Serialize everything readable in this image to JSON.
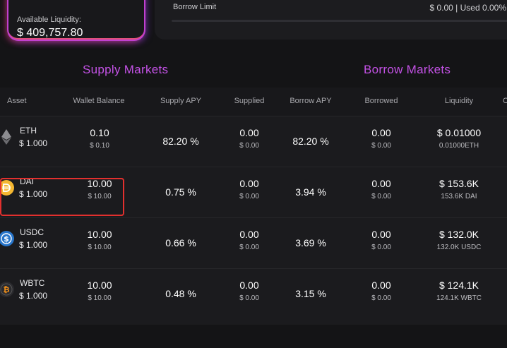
{
  "liquidity": {
    "label": "Available Liquidity:",
    "value": "$ 409,757.80"
  },
  "borrow_limit": {
    "label": "Borrow Limit",
    "value": "$ 0.00 | Used 0.00%"
  },
  "markets": {
    "supply_title": "Supply Markets",
    "borrow_title": "Borrow Markets"
  },
  "columns": {
    "asset": "Asset",
    "wallet_balance": "Wallet Balance",
    "supply_apy": "Supply APY",
    "supplied": "Supplied",
    "borrow_apy": "Borrow APY",
    "borrowed": "Borrowed",
    "liquidity": "Liquidity",
    "extra": "C"
  },
  "rows": [
    {
      "symbol": "ETH",
      "icon": "eth-icon",
      "icon_color": "#2a2a2e",
      "price": "$ 1.000",
      "wallet": "0.10",
      "wallet_usd": "$ 0.10",
      "supply_apy": "82.20 %",
      "supplied": "0.00",
      "supplied_usd": "$ 0.00",
      "borrow_apy": "82.20 %",
      "borrowed": "0.00",
      "borrowed_usd": "$ 0.00",
      "liquidity": "$ 0.01000",
      "liquidity_sub": "0.01000ETH"
    },
    {
      "symbol": "DAI",
      "icon": "dai-icon",
      "icon_color": "#f4b731",
      "price": "$ 1.000",
      "wallet": "10.00",
      "wallet_usd": "$ 10.00",
      "supply_apy": "0.75 %",
      "supplied": "0.00",
      "supplied_usd": "$ 0.00",
      "borrow_apy": "3.94 %",
      "borrowed": "0.00",
      "borrowed_usd": "$ 0.00",
      "liquidity": "$ 153.6K",
      "liquidity_sub": "153.6K DAI"
    },
    {
      "symbol": "USDC",
      "icon": "usdc-icon",
      "icon_color": "#2775ca",
      "price": "$ 1.000",
      "wallet": "10.00",
      "wallet_usd": "$ 10.00",
      "supply_apy": "0.66 %",
      "supplied": "0.00",
      "supplied_usd": "$ 0.00",
      "borrow_apy": "3.69 %",
      "borrowed": "0.00",
      "borrowed_usd": "$ 0.00",
      "liquidity": "$ 132.0K",
      "liquidity_sub": "132.0K USDC"
    },
    {
      "symbol": "WBTC",
      "icon": "wbtc-icon",
      "icon_color": "#2a2a2e",
      "price": "$ 1.000",
      "wallet": "10.00",
      "wallet_usd": "$ 10.00",
      "supply_apy": "0.48 %",
      "supplied": "0.00",
      "supplied_usd": "$ 0.00",
      "borrow_apy": "3.15 %",
      "borrowed": "0.00",
      "borrowed_usd": "$ 0.00",
      "liquidity": "$ 124.1K",
      "liquidity_sub": "124.1K WBTC"
    }
  ],
  "colors": {
    "accent": "#c452e6",
    "highlight": "#e2302e"
  }
}
